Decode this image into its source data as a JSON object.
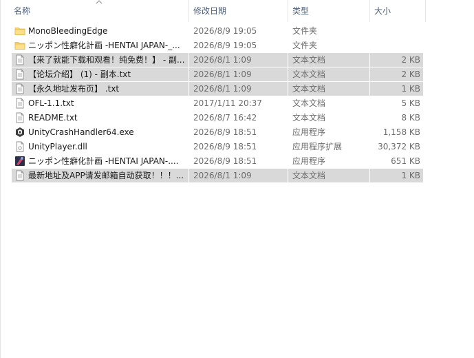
{
  "columns": {
    "name": "名称",
    "date": "修改日期",
    "type": "类型",
    "size": "大小"
  },
  "files": [
    {
      "name": "MonoBleedingEdge",
      "date": "2026/8/9 19:05",
      "type": "文件夹",
      "size": "",
      "icon": "folder-icon",
      "selected": false
    },
    {
      "name": "ニッポン性癖化計画 -HENTAI JAPAN-_...",
      "date": "2026/8/9 19:05",
      "type": "文件夹",
      "size": "",
      "icon": "folder-icon",
      "selected": false
    },
    {
      "name": "【来了就能下载和观看！纯免费！】 - 副...",
      "date": "2026/8/1 1:09",
      "type": "文本文档",
      "size": "2 KB",
      "icon": "text-file-icon",
      "selected": true
    },
    {
      "name": "【论坛介绍】 (1) - 副本.txt",
      "date": "2026/8/1 1:09",
      "type": "文本文档",
      "size": "2 KB",
      "icon": "text-file-icon",
      "selected": true
    },
    {
      "name": "【永久地址发布页】 .txt",
      "date": "2026/8/1 1:09",
      "type": "文本文档",
      "size": "1 KB",
      "icon": "text-file-icon",
      "selected": true
    },
    {
      "name": "OFL-1.1.txt",
      "date": "2017/1/11 20:37",
      "type": "文本文档",
      "size": "5 KB",
      "icon": "text-file-icon",
      "selected": false
    },
    {
      "name": "README.txt",
      "date": "2026/8/7 16:42",
      "type": "文本文档",
      "size": "8 KB",
      "icon": "text-file-icon",
      "selected": false
    },
    {
      "name": "UnityCrashHandler64.exe",
      "date": "2026/8/9 18:51",
      "type": "应用程序",
      "size": "1,158 KB",
      "icon": "unity-app-icon",
      "selected": false
    },
    {
      "name": "UnityPlayer.dll",
      "date": "2026/8/9 18:51",
      "type": "应用程序扩展",
      "size": "30,372 KB",
      "icon": "dll-file-icon",
      "selected": false
    },
    {
      "name": "ニッポン性癖化計画 -HENTAI JAPAN-....",
      "date": "2026/8/9 18:51",
      "type": "应用程序",
      "size": "651 KB",
      "icon": "game-app-icon",
      "selected": false
    },
    {
      "name": "最新地址及APP请发邮箱自动获取！！！...",
      "date": "2026/8/1 1:09",
      "type": "文本文档",
      "size": "1 KB",
      "icon": "text-file-icon",
      "selected": true
    }
  ]
}
